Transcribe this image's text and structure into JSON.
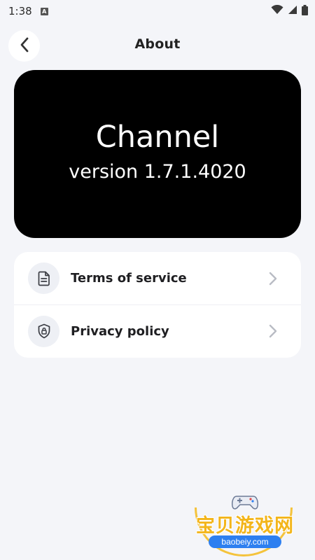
{
  "status_bar": {
    "time": "1:38",
    "notification_letter": "A"
  },
  "header": {
    "title": "About"
  },
  "hero": {
    "app_name": "Channel",
    "version": "version 1.7.1.4020"
  },
  "menu": {
    "items": [
      {
        "label": "Terms of service",
        "icon": "document-icon"
      },
      {
        "label": "Privacy policy",
        "icon": "shield-lock-icon"
      }
    ]
  },
  "watermark": {
    "text": "宝贝游戏网",
    "domain": "baobeiy.com"
  },
  "colors": {
    "background": "#f4f5f9",
    "hero_background": "#000000",
    "card_background": "#ffffff",
    "icon_circle": "#eef0f5",
    "chevron": "#b9bcc4"
  }
}
